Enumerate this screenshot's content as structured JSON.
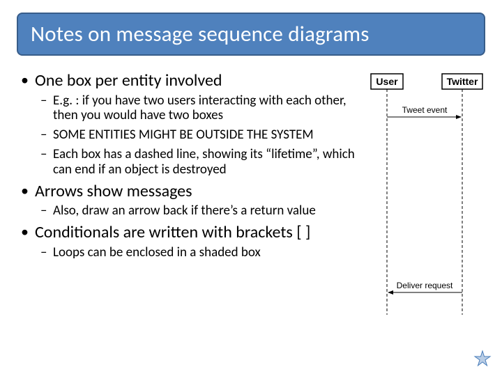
{
  "title": "Notes on message sequence diagrams",
  "bullets": [
    {
      "text": "One box per entity involved",
      "children": [
        "E.g. : if you have two users interacting with each other, then you would have two boxes",
        "SOME ENTITIES MIGHT BE OUTSIDE THE SYSTEM",
        "Each box has a dashed line, showing its “lifetime”, which can end if an object is destroyed"
      ]
    },
    {
      "text": "Arrows show messages",
      "children": [
        "Also, draw an arrow back if there’s a return value"
      ]
    },
    {
      "text": "Conditionals are written with brackets  [ ]",
      "children": [
        "Loops can be enclosed in a shaded box"
      ]
    }
  ],
  "diagram": {
    "entity1": "User",
    "entity2": "Twitter",
    "msg1": "Tweet event",
    "msg2": "Deliver request"
  }
}
